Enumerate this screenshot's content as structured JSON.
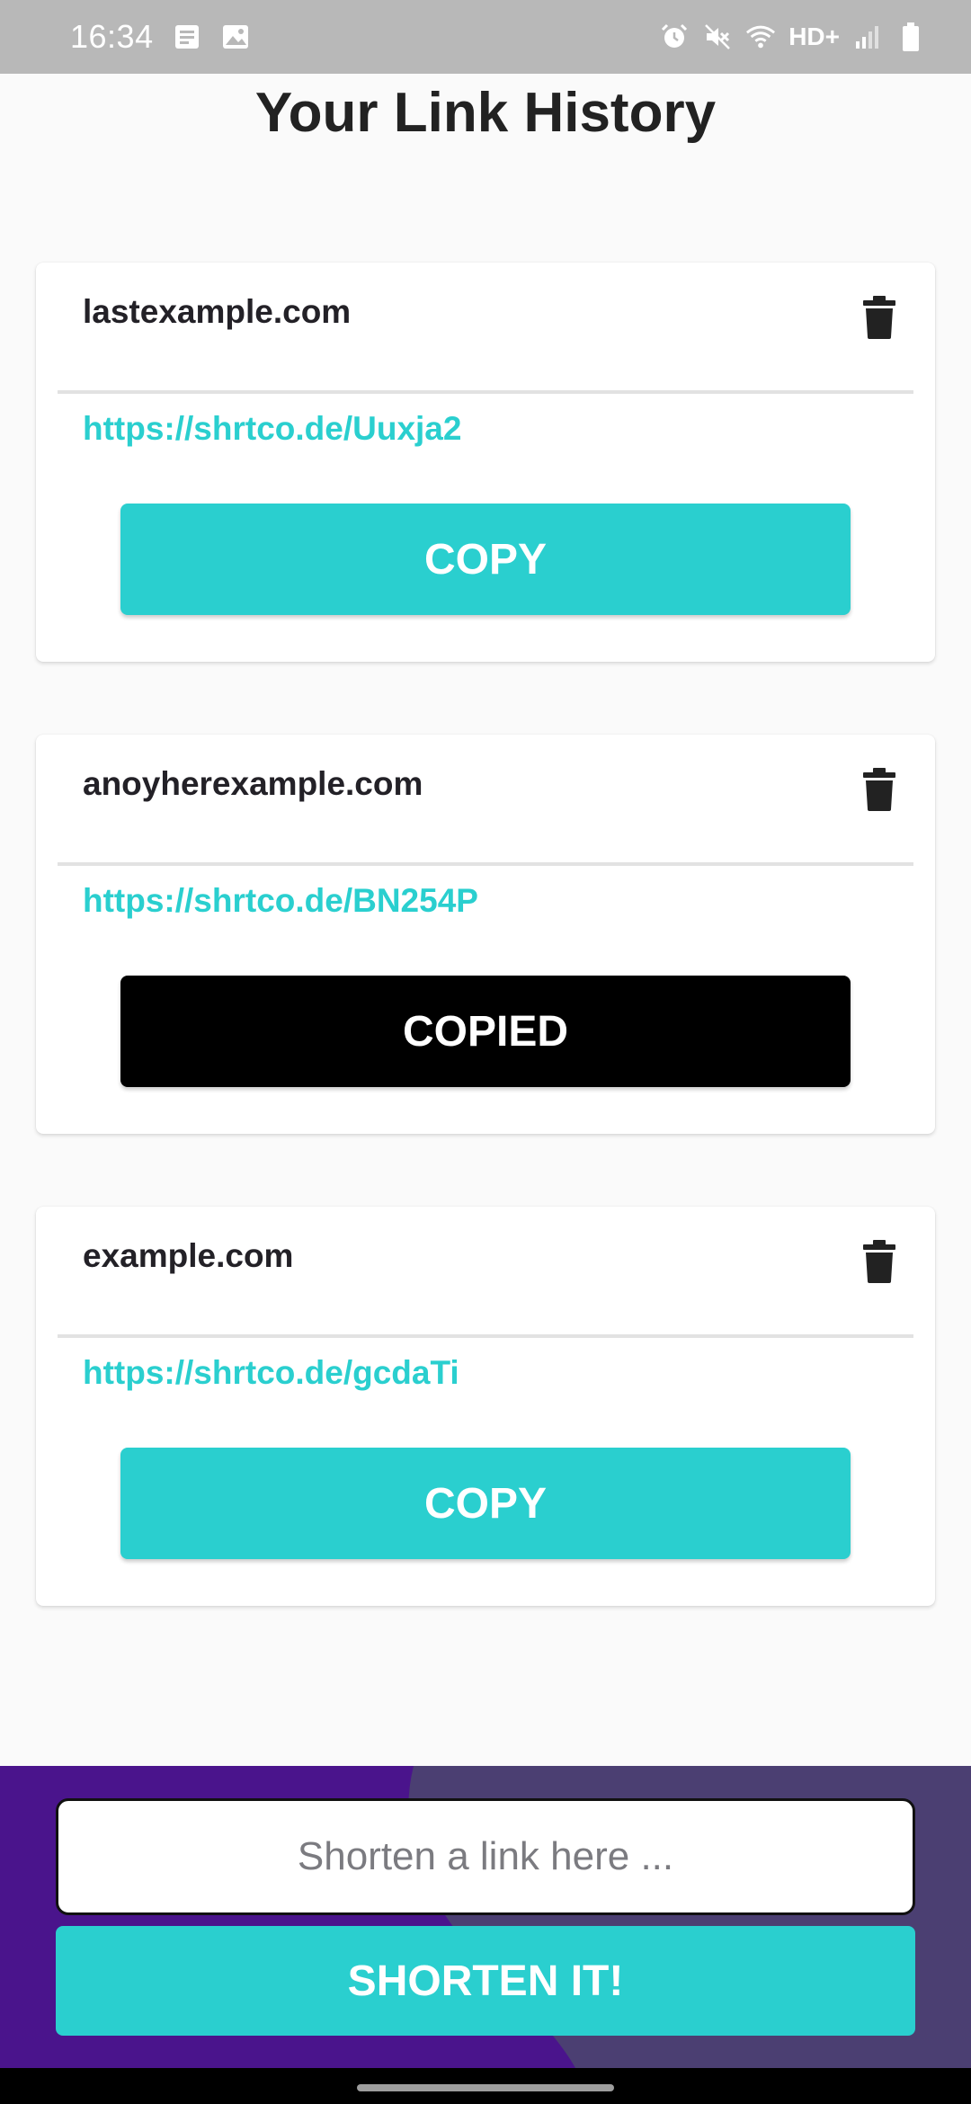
{
  "status_bar": {
    "time": "16:34",
    "network_label": "HD+",
    "icons": [
      "notes-icon",
      "image-icon",
      "alarm-icon",
      "mute-icon",
      "wifi-icon",
      "signal-icon",
      "battery-icon"
    ]
  },
  "page": {
    "title": "Your Link History"
  },
  "links": [
    {
      "original": "lastexample.com",
      "short": "https://shrtco.de/Uuxja2",
      "button_label": "COPY",
      "copied": false
    },
    {
      "original": "anoyherexample.com",
      "short": "https://shrtco.de/BN254P",
      "button_label": "COPIED",
      "copied": true
    },
    {
      "original": "example.com",
      "short": "https://shrtco.de/gcdaTi",
      "button_label": "COPY",
      "copied": false
    }
  ],
  "shorten_form": {
    "input_placeholder": "Shorten a link here ...",
    "input_value": "",
    "submit_label": "SHORTEN IT!"
  },
  "colors": {
    "accent": "#2acfcf",
    "copied": "#000000",
    "panel": "#4a148c",
    "panel_shape": "#4b3f72",
    "status_bar": "#b8b8b8"
  }
}
